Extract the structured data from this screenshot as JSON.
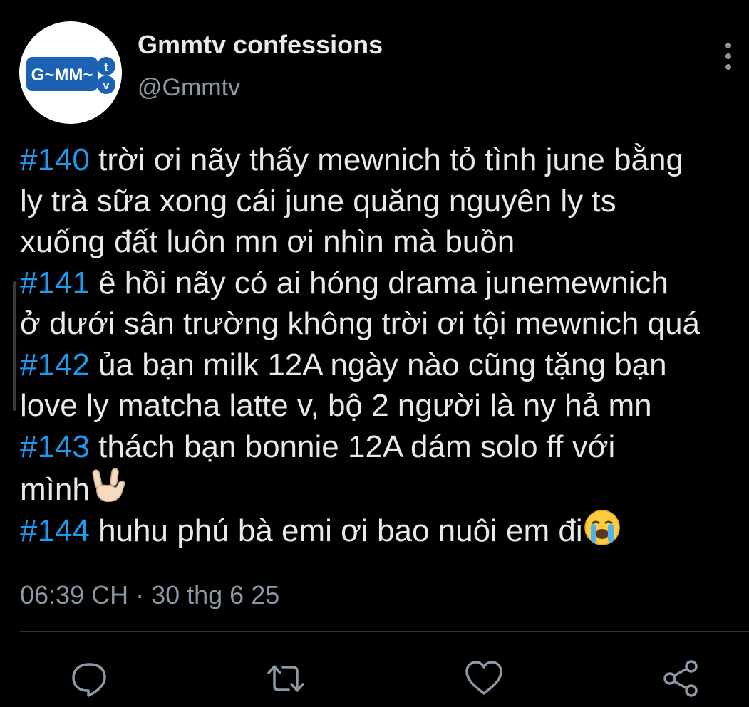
{
  "profile": {
    "display_name": "Gmmtv confessions",
    "handle": "@Gmmtv",
    "avatar_logo_text": "G~MM~tv"
  },
  "tweet": {
    "lines": [
      {
        "tag": "#140",
        "text": " trời ơi nãy thấy mewnich tỏ tình june bằng"
      },
      {
        "tag": "",
        "text": "ly trà sữa xong cái june quăng nguyên ly ts"
      },
      {
        "tag": "",
        "text": "xuống đất luôn mn ơi nhìn mà buồn"
      },
      {
        "tag": "#141",
        "text": " ê hồi nãy có ai hóng drama junemewnich"
      },
      {
        "tag": "",
        "text": "ở dưới sân trường không trời ơi tội mewnich quá"
      },
      {
        "tag": "#142",
        "text": " ủa bạn milk 12A ngày nào cũng tặng bạn"
      },
      {
        "tag": "",
        "text": "love ly matcha latte v, bộ 2 người là ny hả mn"
      },
      {
        "tag": "#143",
        "text": " thách bạn bonnie 12A dám solo ff với"
      },
      {
        "tag": "",
        "text": "mình"
      },
      {
        "tag": "#144",
        "text": " huhu phú bà emi ơi bao nuôi em đi"
      }
    ],
    "emojis": {
      "line_9": "love-you-gesture-emoji",
      "line_10": "loudly-crying-face-emoji"
    },
    "timestamp": "06:39 CH · 30 thg 6 25"
  },
  "actions": {
    "reply_icon": "reply-icon",
    "retweet_icon": "retweet-icon",
    "like_icon": "heart-icon",
    "share_icon": "share-icon"
  },
  "colors": {
    "background": "#000000",
    "text": "#e7e9ea",
    "secondary": "#8b98a5",
    "hashtag": "#1d9bf0",
    "divider": "#2f3336",
    "logo_blue": "#1b62b5"
  }
}
